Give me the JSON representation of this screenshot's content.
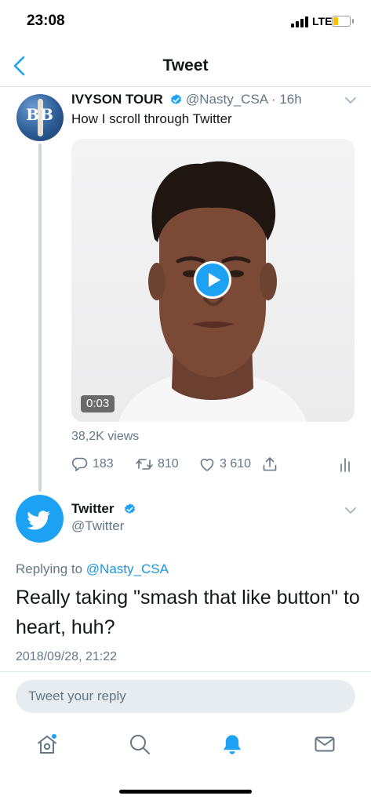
{
  "status_bar": {
    "time": "23:08",
    "network": "LTE",
    "colors": {
      "battery": "#f5c400"
    }
  },
  "header": {
    "title": "Tweet",
    "back_icon": "chevron-left-icon"
  },
  "tweet": {
    "author_name": "IVYSON TOUR",
    "handle": "@Nasty_CSA",
    "separator": "·",
    "age": "16h",
    "text": "How I scroll through Twitter",
    "avatar_text": "BB",
    "video": {
      "duration": "0:03",
      "views": "38,2K views"
    },
    "actions": {
      "replies": "183",
      "retweets": "810",
      "likes": "3 610"
    }
  },
  "reply_tweet": {
    "author_name": "Twitter",
    "handle": "@Twitter",
    "replying_prefix": "Replying to",
    "replying_to": "@Nasty_CSA",
    "text": "Really taking \"smash that like button\" to heart, huh?",
    "date": "2018/09/28, 21:22"
  },
  "compose": {
    "placeholder": "Tweet your reply"
  },
  "tab_bar": [
    "home-icon",
    "search-icon",
    "notifications-icon",
    "messages-icon"
  ],
  "colors": {
    "accent": "#1da1f2",
    "text": "#14171a",
    "secondary": "#657786",
    "divider": "#e1e8ed"
  }
}
